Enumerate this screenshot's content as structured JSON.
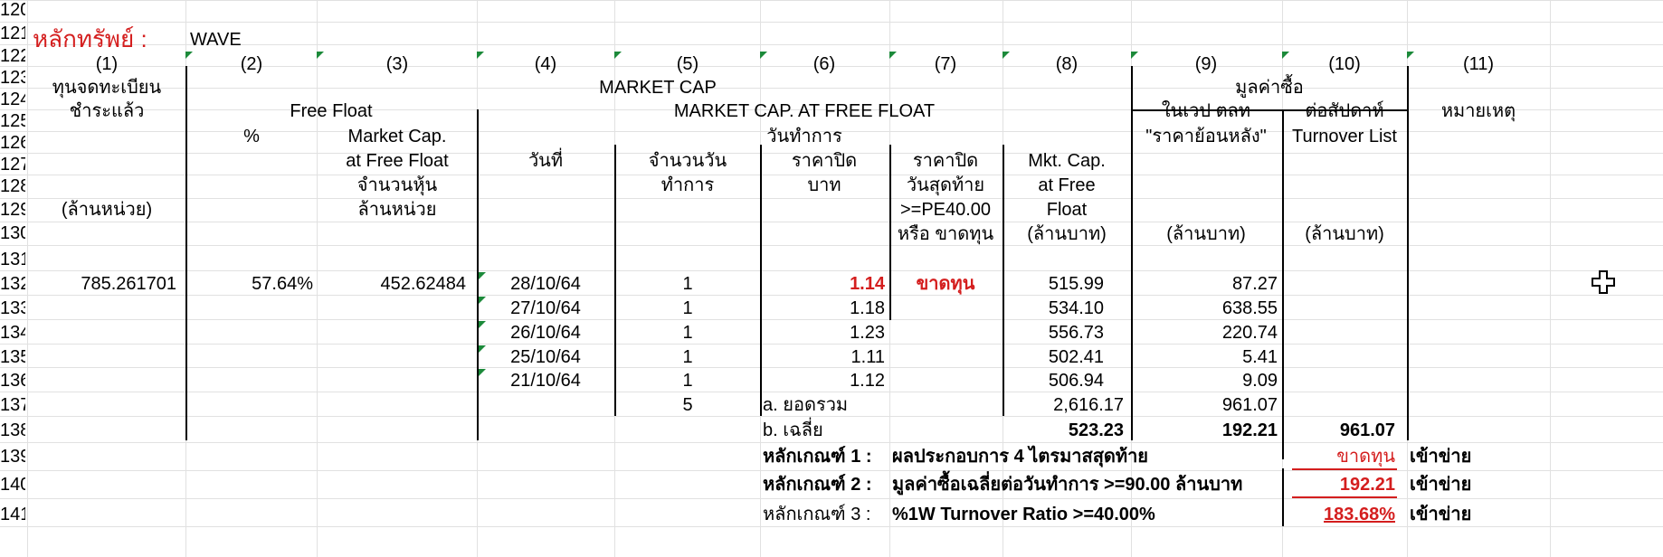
{
  "row_numbers": [
    "120",
    "121",
    "122",
    "123",
    "124",
    "125",
    "126",
    "127",
    "128",
    "129",
    "130",
    "131",
    "132",
    "133",
    "134",
    "135",
    "136",
    "137",
    "138",
    "139",
    "140",
    "141"
  ],
  "security": {
    "label": "หลักทรัพย์ :",
    "value": "WAVE"
  },
  "col_numbers": [
    "(1)",
    "(2)",
    "(3)",
    "(4)",
    "(5)",
    "(6)",
    "(7)",
    "(8)",
    "(9)",
    "(10)",
    "(11)"
  ],
  "headers": {
    "paid_capital_1": "ทุนจดทะเบียน",
    "paid_capital_2": "ชำระแล้ว",
    "paid_capital_unit": "(ล้านหน่วย)",
    "market_cap": "MARKET CAP",
    "trade_value": "มูลค่าซื้อ",
    "free_float": "Free Float",
    "market_cap_free_float": "MARKET CAP. AT FREE FLOAT",
    "in_wave": "ในเวป ตลท",
    "per_week": "ต่อสัปดาห์",
    "remarks": "หมายเหตุ",
    "percent": "%",
    "mkt_cap": "Market Cap.",
    "trading_day": "วันทำการ",
    "back_price": "\"ราคาย้อนหลัง\"",
    "turnover_list": "Turnover List",
    "at_free_float": "at Free Float",
    "date": "วันที่",
    "num_days": "จำนวนวัน",
    "close_price": "ราคาปิด",
    "close_price2": "ราคาปิด",
    "mktcap_short": "Mkt. Cap.",
    "num_shares": "จำนวนหุ้น",
    "trading": "ทำการ",
    "baht": "บาท",
    "last_day": "วันสุดท้าย",
    "at_free": "at Free",
    "million_units": "ล้านหน่วย",
    "pe_cond": ">=PE40.00",
    "float": "Float",
    "or_loss": "หรือ ขาดทุน",
    "million_baht_8": "(ล้านบาท)",
    "million_baht_9": "(ล้านบาท)",
    "million_baht_10": "(ล้านบาท)"
  },
  "summary_top": {
    "paid_capital": "785.261701",
    "free_float_pct": "57.64%",
    "mkt_cap_ff": "452.62484"
  },
  "rows": [
    {
      "date": "28/10/64",
      "days": "1",
      "close": "1.14",
      "last": "ขาดทุน",
      "mktcap": "515.99",
      "value": "87.27"
    },
    {
      "date": "27/10/64",
      "days": "1",
      "close": "1.18",
      "last": "",
      "mktcap": "534.10",
      "value": "638.55"
    },
    {
      "date": "26/10/64",
      "days": "1",
      "close": "1.23",
      "last": "",
      "mktcap": "556.73",
      "value": "220.74"
    },
    {
      "date": "25/10/64",
      "days": "1",
      "close": "1.11",
      "last": "",
      "mktcap": "502.41",
      "value": "5.41"
    },
    {
      "date": "21/10/64",
      "days": "1",
      "close": "1.12",
      "last": "",
      "mktcap": "506.94",
      "value": "9.09"
    }
  ],
  "total": {
    "days": "5",
    "label": "a. ยอดรวม",
    "mktcap": "2,616.17",
    "value": "961.07"
  },
  "average": {
    "label": "b. เฉลี่ย",
    "mktcap": "523.23",
    "value": "192.21",
    "turnover": "961.07"
  },
  "criteria": [
    {
      "label": "หลักเกณฑ์ 1 :",
      "desc": "ผลประกอบการ 4 ไตรมาสสุดท้าย",
      "result": "ขาดทุน",
      "status": "เข้าข่าย"
    },
    {
      "label": "หลักเกณฑ์ 2 :",
      "desc": "มูลค่าซื้อเฉลี่ยต่อวันทำการ >=90.00 ล้านบาท",
      "result": "192.21",
      "status": "เข้าข่าย"
    },
    {
      "label": "หลักเกณฑ์ 3 :",
      "desc": "%1W Turnover Ratio >=40.00%",
      "result": "183.68%",
      "status": "เข้าข่าย"
    }
  ],
  "colors": {
    "red": "#d41e1e",
    "grid": "#e1e1e1",
    "marker": "#1c8a3a"
  }
}
